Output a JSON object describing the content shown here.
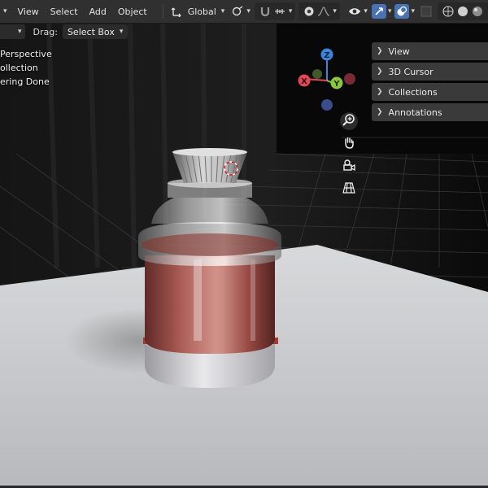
{
  "header": {
    "menu": [
      "View",
      "Select",
      "Add",
      "Object"
    ],
    "transform_orientation": "Global"
  },
  "toolbar": {
    "drag_label": "Drag:",
    "drag_value": "Select Box"
  },
  "viewport_info": {
    "lines": [
      "Perspective",
      "ollection",
      "ering Done"
    ]
  },
  "npanel": {
    "tabs": [
      "View",
      "3D Cursor",
      "Collections",
      "Annotations"
    ]
  },
  "gizmo": {
    "x": "X",
    "y": "Y",
    "z": "Z",
    "colors": {
      "x": "#e0485a",
      "y": "#8cc63f",
      "z": "#3c85d8",
      "neg": "#444c7c"
    }
  },
  "icons": {
    "transform": "transform-arrows-icon",
    "snap": "magnet-icon",
    "proportional": "proportional-edit-icon",
    "visibility": "eye-icon",
    "gizmo": "gizmo-icon",
    "overlay": "overlay-icon",
    "xray": "xray-icon",
    "shading": [
      "wireframe-icon",
      "solid-icon",
      "material-icon",
      "rendered-icon"
    ],
    "nav": [
      "zoom-icon",
      "hand-icon",
      "camera-icon",
      "grid-icon"
    ]
  },
  "colors": {
    "header_bg": "#303030",
    "active": "#4772b3",
    "liquid": "#8a2a24"
  }
}
